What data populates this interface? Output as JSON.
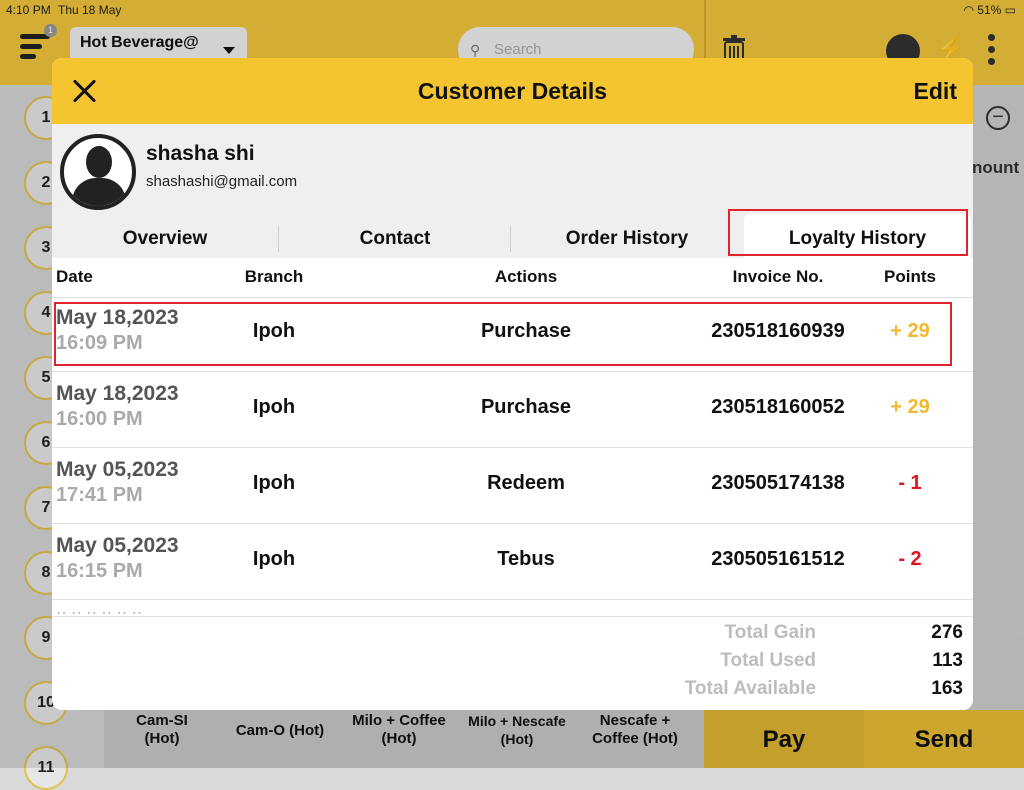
{
  "status_bar": {
    "time": "4:10 PM",
    "date": "Thu 18 May",
    "battery": "51%"
  },
  "app": {
    "branch": "Hot Beverage@",
    "search_placeholder": "Search",
    "menu_badge": "1",
    "table_numbers": [
      "1",
      "2",
      "3",
      "4",
      "5",
      "6",
      "7",
      "8",
      "9",
      "10",
      "11"
    ],
    "amount_label": "nount",
    "products": [
      "Cam-SI (Hot)",
      "Cam-O (Hot)",
      "Milo + Coffee (Hot)",
      "Milo + Nescafe (Hot)",
      "Nescafe + Coffee (Hot)"
    ],
    "pay_label": "Pay",
    "send_label": "Send"
  },
  "modal": {
    "title": "Customer Details",
    "edit_label": "Edit",
    "customer": {
      "name": "shasha shi",
      "email": "shashashi@gmail.com"
    },
    "tabs": [
      "Overview",
      "Contact",
      "Order History",
      "Loyalty History"
    ],
    "active_tab": "Loyalty History",
    "columns": [
      "Date",
      "Branch",
      "Actions",
      "Invoice No.",
      "Points"
    ],
    "rows": [
      {
        "date": "May 18,2023",
        "time": "16:09 PM",
        "branch": "Ipoh",
        "action": "Purchase",
        "invoice": "230518160939",
        "points": "+ 29",
        "points_color": "#f2b830"
      },
      {
        "date": "May 18,2023",
        "time": "16:00 PM",
        "branch": "Ipoh",
        "action": "Purchase",
        "invoice": "230518160052",
        "points": "+ 29",
        "points_color": "#f2b830"
      },
      {
        "date": "May 05,2023",
        "time": "17:41 PM",
        "branch": "Ipoh",
        "action": "Redeem",
        "invoice": "230505174138",
        "points": "- 1",
        "points_color": "#e0141e"
      },
      {
        "date": "May 05,2023",
        "time": "16:15 PM",
        "branch": "Ipoh",
        "action": "Tebus",
        "invoice": "230505161512",
        "points": "- 2",
        "points_color": "#e0141e"
      }
    ],
    "totals": [
      {
        "label": "Total Gain",
        "value": "276"
      },
      {
        "label": "Total Used",
        "value": "113"
      },
      {
        "label": "Total Available",
        "value": "163"
      }
    ]
  },
  "colors": {
    "accent": "#f4c531",
    "highlight": "#e0242e"
  }
}
